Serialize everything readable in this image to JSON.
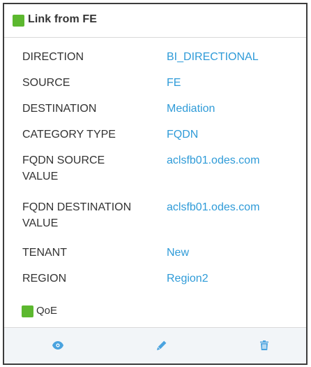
{
  "card": {
    "title": "Link from FE",
    "status_color": "#5cb82f",
    "details": [
      {
        "label": "DIRECTION",
        "value": "BI_DIRECTIONAL"
      },
      {
        "label": "SOURCE",
        "value": "FE"
      },
      {
        "label": "DESTINATION",
        "value": "Mediation"
      },
      {
        "label": "CATEGORY TYPE",
        "value": "FQDN"
      },
      {
        "label": "FQDN SOURCE VALUE",
        "value": "aclsfb01.odes.com"
      },
      {
        "label": "FQDN DESTINATION VALUE",
        "value": "aclsfb01.odes.com"
      },
      {
        "label": "TENANT",
        "value": "New"
      },
      {
        "label": "REGION",
        "value": "Region2"
      }
    ],
    "qoe": {
      "label": "QoE",
      "status_color": "#5cb82f"
    }
  },
  "actions": {
    "view_icon": "eye-icon",
    "edit_icon": "pencil-icon",
    "delete_icon": "trash-icon",
    "icon_color": "#4aa3df"
  },
  "colors": {
    "label": "#333333",
    "value": "#2f9bd8",
    "footer_bg": "#f2f5f8",
    "border": "#3c3c3c"
  }
}
